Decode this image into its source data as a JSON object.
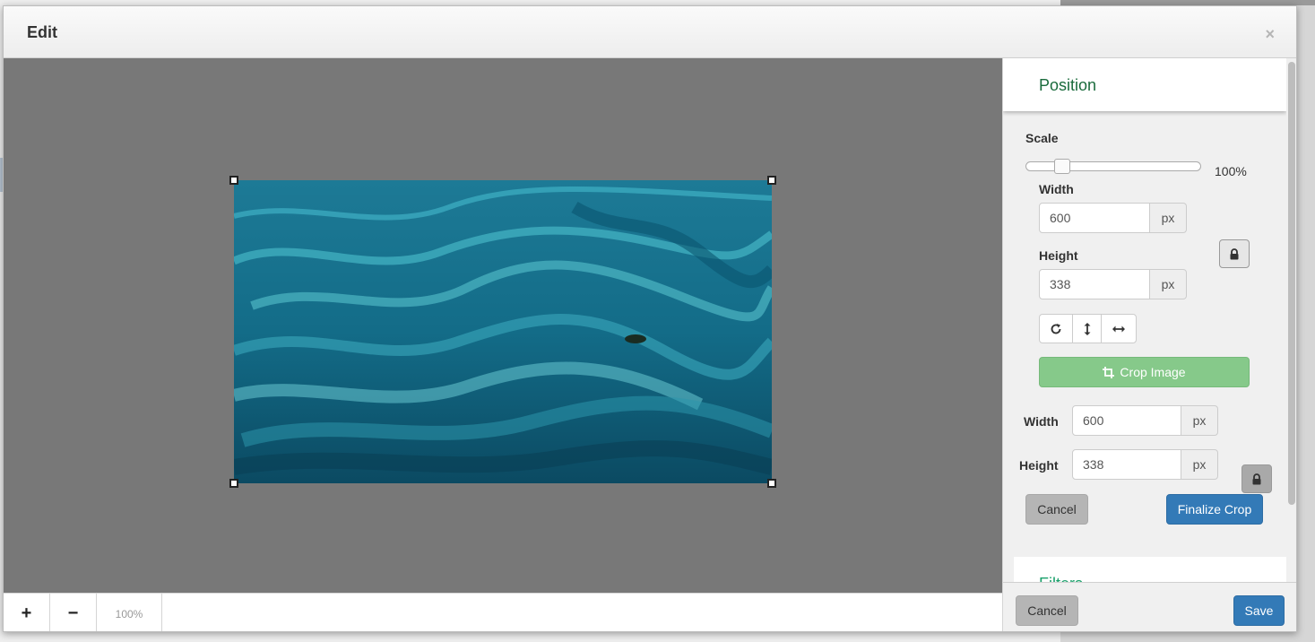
{
  "dialog": {
    "title": "Edit",
    "close_glyph": "×"
  },
  "canvas": {
    "background": "#787878",
    "image_alt": "Aerial view of turquoise ocean sandbars"
  },
  "zoom": {
    "plus": "+",
    "minus": "−",
    "level": "100%"
  },
  "panel": {
    "title": "Position",
    "scale": {
      "label": "Scale",
      "value_text": "100%",
      "level_fraction": 0.18
    },
    "size": {
      "width_label": "Width",
      "width_value": "600",
      "width_unit": "px",
      "height_label": "Height",
      "height_value": "338",
      "height_unit": "px"
    },
    "transform_icons": [
      "rotate-icon",
      "flip-vertical-icon",
      "flip-horizontal-icon"
    ],
    "crop_button": "Crop Image",
    "crop": {
      "width_label": "Width",
      "width_value": "600",
      "width_unit": "px",
      "height_label": "Height",
      "height_value": "338",
      "height_unit": "px",
      "cancel": "Cancel",
      "finalize": "Finalize Crop"
    },
    "next_section": "Filters"
  },
  "footer": {
    "cancel": "Cancel",
    "save": "Save"
  },
  "colors": {
    "accent_green": "#1a6b3c",
    "primary_blue": "#337ab7",
    "crop_green": "#86c98a"
  }
}
